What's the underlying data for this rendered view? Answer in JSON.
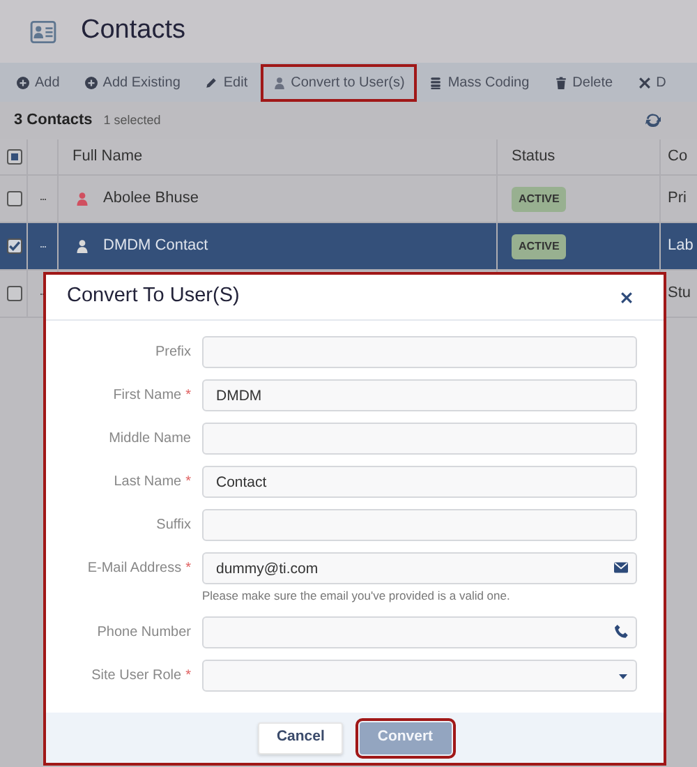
{
  "page": {
    "title": "Contacts"
  },
  "toolbar": [
    {
      "label": "Add",
      "kind": "add",
      "highlighted": false
    },
    {
      "label": "Add Existing",
      "kind": "add",
      "highlighted": false
    },
    {
      "label": "Edit",
      "kind": "edit",
      "highlighted": false
    },
    {
      "label": "Convert to User(s)",
      "kind": "convert",
      "highlighted": true
    },
    {
      "label": "Mass Coding",
      "kind": "coding",
      "highlighted": false
    },
    {
      "label": "Delete",
      "kind": "delete",
      "highlighted": false
    },
    {
      "label": "D",
      "kind": "remove",
      "highlighted": false
    }
  ],
  "summary": {
    "count": "3 Contacts",
    "selected": "1 selected"
  },
  "table": {
    "select_all": {
      "indeterminate": true
    },
    "columns": [
      "Full Name",
      "Status",
      "Co"
    ],
    "rows": [
      {
        "checked": false,
        "selected": false,
        "name": "Abolee Bhuse",
        "status": "ACTIVE",
        "column_4": "Pri"
      },
      {
        "checked": true,
        "selected": true,
        "name": "DMDM Contact",
        "status": "ACTIVE",
        "column_4": "Lab"
      },
      {
        "checked": false,
        "selected": false,
        "column_4": "Stu"
      }
    ]
  },
  "dialog": {
    "title": "Convert To User(S)",
    "fields": [
      {
        "label": "Prefix",
        "kind": "text"
      },
      {
        "label": "First Name",
        "required_mark": "*",
        "kind": "text",
        "value": "DMDM"
      },
      {
        "label": "Middle Name",
        "kind": "text"
      },
      {
        "label": "Last Name",
        "required_mark": "*",
        "kind": "text",
        "value": "Contact"
      },
      {
        "label": "Suffix",
        "kind": "text"
      },
      {
        "label": "E-Mail Address",
        "required_mark": "*",
        "kind": "email",
        "value": "dummy@ti.com",
        "help": "Please make sure the email you've provided is a valid one."
      },
      {
        "label": "Phone Number",
        "kind": "phone"
      },
      {
        "label": "Site User Role",
        "required_mark": "*",
        "kind": "select"
      }
    ],
    "buttons": [
      {
        "label": "Cancel",
        "kind": "secondary",
        "highlighted": false
      },
      {
        "label": "Convert",
        "kind": "primary",
        "highlighted": true
      }
    ]
  }
}
